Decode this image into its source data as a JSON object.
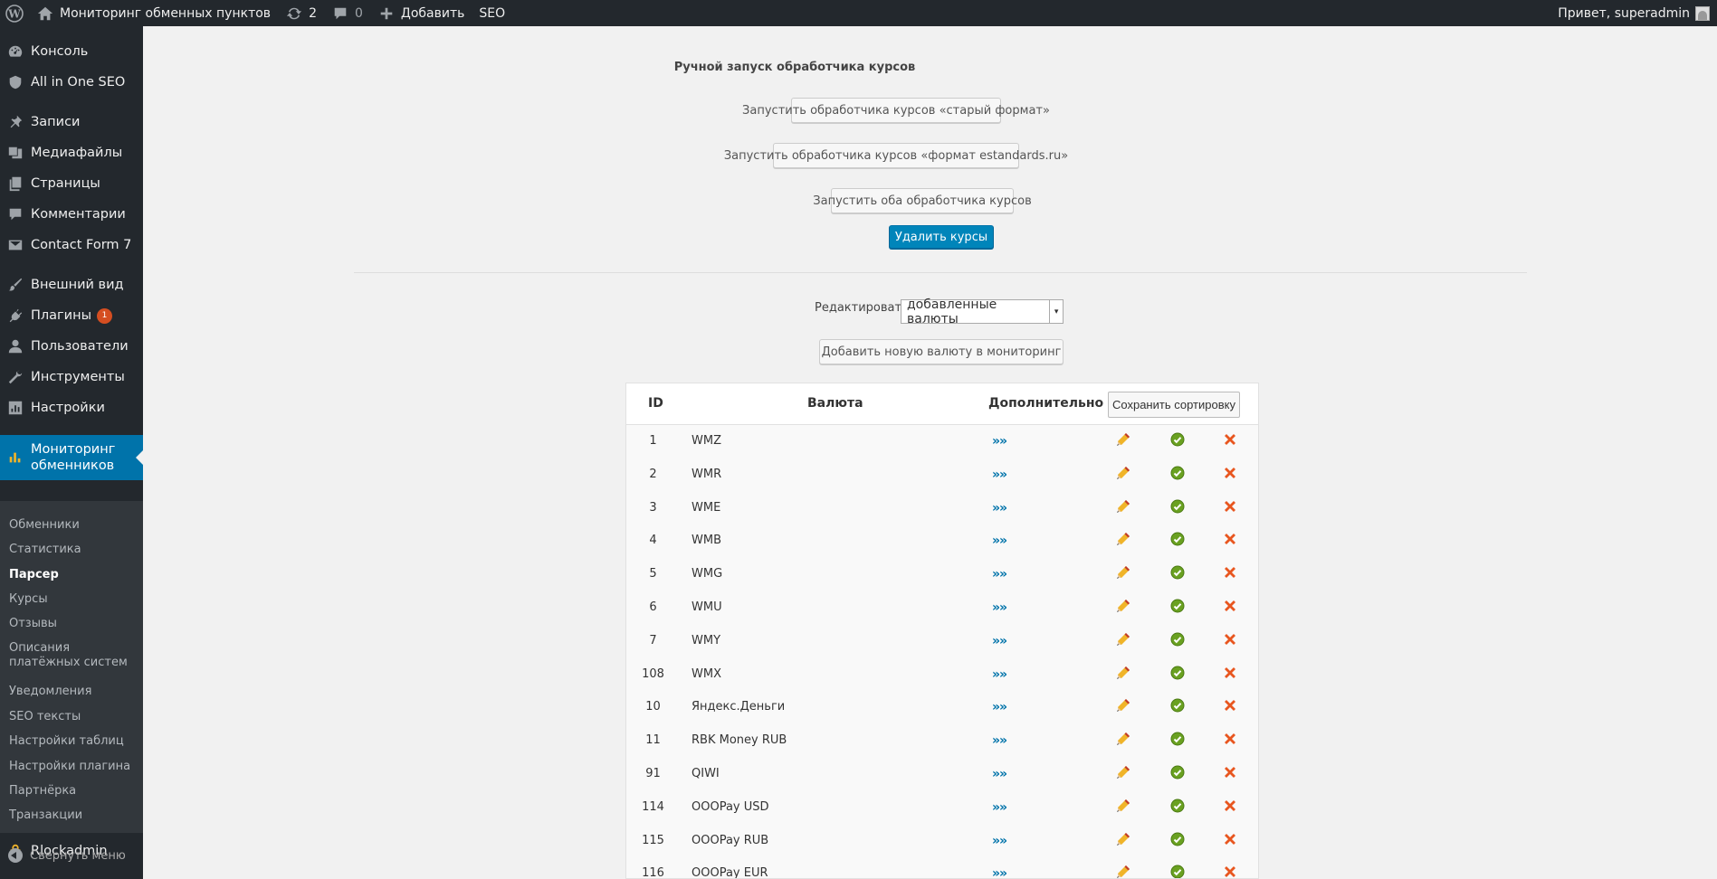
{
  "adminbar": {
    "site_name": "Мониторинг обменных пунктов",
    "updates_count": "2",
    "comments_count": "0",
    "add_label": "Добавить",
    "seo_label": "SEO",
    "greeting": "Привет, superadmin"
  },
  "sidebar": {
    "items": [
      {
        "label": "Консоль",
        "icon": "dashboard-icon"
      },
      {
        "label": "All in One SEO",
        "icon": "shield-icon"
      },
      {
        "label": "Записи",
        "icon": "pin-icon"
      },
      {
        "label": "Медиафайлы",
        "icon": "media-icon"
      },
      {
        "label": "Страницы",
        "icon": "pages-icon"
      },
      {
        "label": "Комментарии",
        "icon": "comment-icon"
      },
      {
        "label": "Contact Form 7",
        "icon": "mail-icon"
      },
      {
        "label": "Внешний вид",
        "icon": "brush-icon"
      },
      {
        "label": "Плагины",
        "icon": "plugin-icon",
        "badge": "1"
      },
      {
        "label": "Пользователи",
        "icon": "users-icon"
      },
      {
        "label": "Инструменты",
        "icon": "wrench-icon"
      },
      {
        "label": "Настройки",
        "icon": "settings-icon"
      },
      {
        "label": "Мониторинг обменников",
        "icon": "chart-icon"
      },
      {
        "label": "Rlockadmin",
        "icon": "lock-icon"
      }
    ],
    "submenu": [
      "Обменники",
      "Статистика",
      "Парсер",
      "Курсы",
      "Отзывы",
      "Описания платёжных систем",
      "Уведомления",
      "SEO тексты",
      "Настройки таблиц",
      "Настройки плагина",
      "Партнёрка",
      "Транзакции"
    ],
    "active_submenu": "Парсер",
    "collapse_label": "Свернуть меню"
  },
  "main": {
    "title": "Ручной запуск обработчика курсов",
    "btn_old_format": "Запустить обработчика курсов «старый формат»",
    "btn_estandards": "Запустить обработчика курсов «формат estandards.ru»",
    "btn_both": "Запустить оба обработчика курсов",
    "btn_delete": "Удалить курсы",
    "edit_label": "Редактировать",
    "edit_select_value": "добавленные валюты",
    "btn_add_currency": "Добавить новую валюту в мониторинг"
  },
  "table": {
    "headers": {
      "id": "ID",
      "currency": "Валюта",
      "extra": "Дополнительно"
    },
    "save_sort_label": "Сохранить сортировку",
    "more_link": "»»",
    "rows": [
      {
        "id": "1",
        "name": "WMZ"
      },
      {
        "id": "2",
        "name": "WMR"
      },
      {
        "id": "3",
        "name": "WME"
      },
      {
        "id": "4",
        "name": "WMB"
      },
      {
        "id": "5",
        "name": "WMG"
      },
      {
        "id": "6",
        "name": "WMU"
      },
      {
        "id": "7",
        "name": "WMY"
      },
      {
        "id": "108",
        "name": "WMX"
      },
      {
        "id": "10",
        "name": "Яндекс.Деньги"
      },
      {
        "id": "11",
        "name": "RBK Money RUB"
      },
      {
        "id": "91",
        "name": "QIWI"
      },
      {
        "id": "114",
        "name": "OOOPay USD"
      },
      {
        "id": "115",
        "name": "OOOPay RUB"
      },
      {
        "id": "116",
        "name": "OOOPay EUR"
      }
    ]
  },
  "colors": {
    "adminbar_bg": "#23282d",
    "accent": "#0073aa",
    "primary_button": "#0085ba",
    "badge": "#d54e21",
    "delete_icon": "#e8561f",
    "ok_icon": "#6aa121",
    "edit_icon": "#f0b429"
  }
}
